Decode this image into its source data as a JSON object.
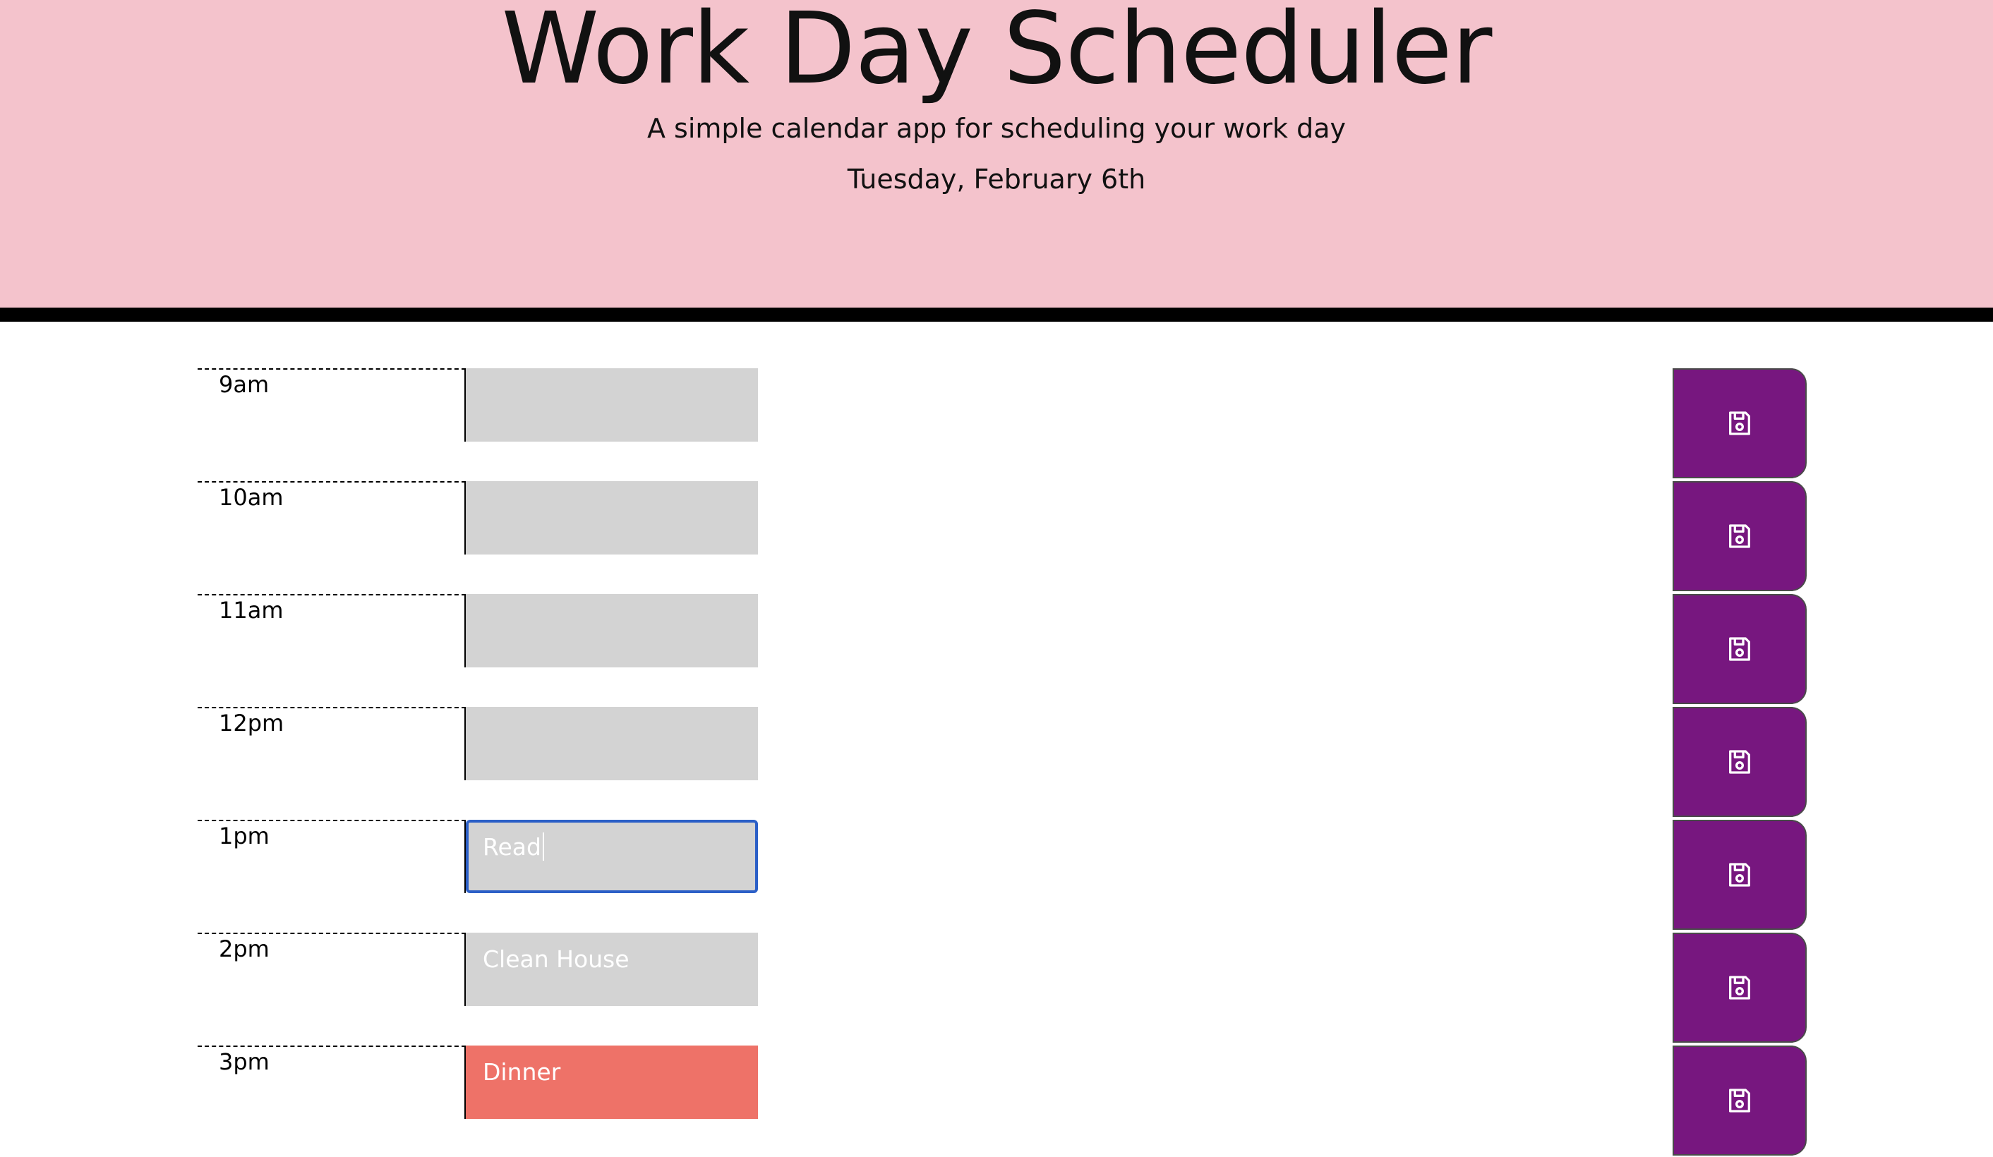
{
  "header": {
    "title": "Work Day Scheduler",
    "subtitle": "A simple calendar app for scheduling your work day",
    "date": "Tuesday, February 6th"
  },
  "colors": {
    "header_bg": "#f4c3cc",
    "past_block": "#d3d3d3",
    "present_block": "#ee7268",
    "save_button": "#77177f",
    "focus_border": "#2b5fc7"
  },
  "rows": [
    {
      "hour": "9am",
      "text": "",
      "state": "past",
      "save_icon": "floppy-disk-icon"
    },
    {
      "hour": "10am",
      "text": "",
      "state": "past",
      "save_icon": "floppy-disk-icon"
    },
    {
      "hour": "11am",
      "text": "",
      "state": "past",
      "save_icon": "floppy-disk-icon"
    },
    {
      "hour": "12pm",
      "text": "",
      "state": "past",
      "save_icon": "floppy-disk-icon"
    },
    {
      "hour": "1pm",
      "text": "Read",
      "state": "past",
      "focused": true,
      "save_icon": "floppy-disk-icon"
    },
    {
      "hour": "2pm",
      "text": "Clean House",
      "state": "past",
      "save_icon": "floppy-disk-icon"
    },
    {
      "hour": "3pm",
      "text": "Dinner",
      "state": "present",
      "save_icon": "floppy-disk-icon"
    }
  ]
}
